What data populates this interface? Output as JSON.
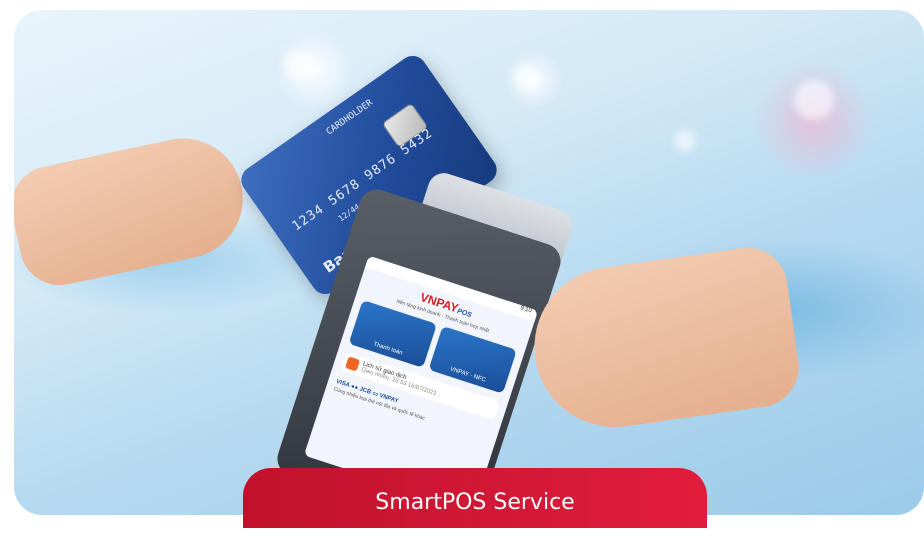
{
  "card": {
    "number_top": "1234 5678 9876 5432",
    "holder": "CARDHOLDER",
    "expiry": "12/44",
    "bank_name": "Bank Name"
  },
  "pos_screen": {
    "status_time": "9:10",
    "brand": "VNPAY",
    "brand_sub": "POS",
    "tagline": "Nền tảng kinh doanh - Thanh toán hợp nhất",
    "tile_pay_label": "Thanh toán",
    "tile_qr_label": "VNPAY · NFC",
    "history_title": "Lịch sử giao dịch",
    "history_sub": "Giao nhiều: 16:53 16/07/2021",
    "brands_row": "VISA   ●●   JCB   ▭   VNPAY",
    "brands_caption": "Cùng nhiều loại thẻ nội địa và quốc tế khác"
  },
  "cta": {
    "label": "SmartPOS Service"
  }
}
